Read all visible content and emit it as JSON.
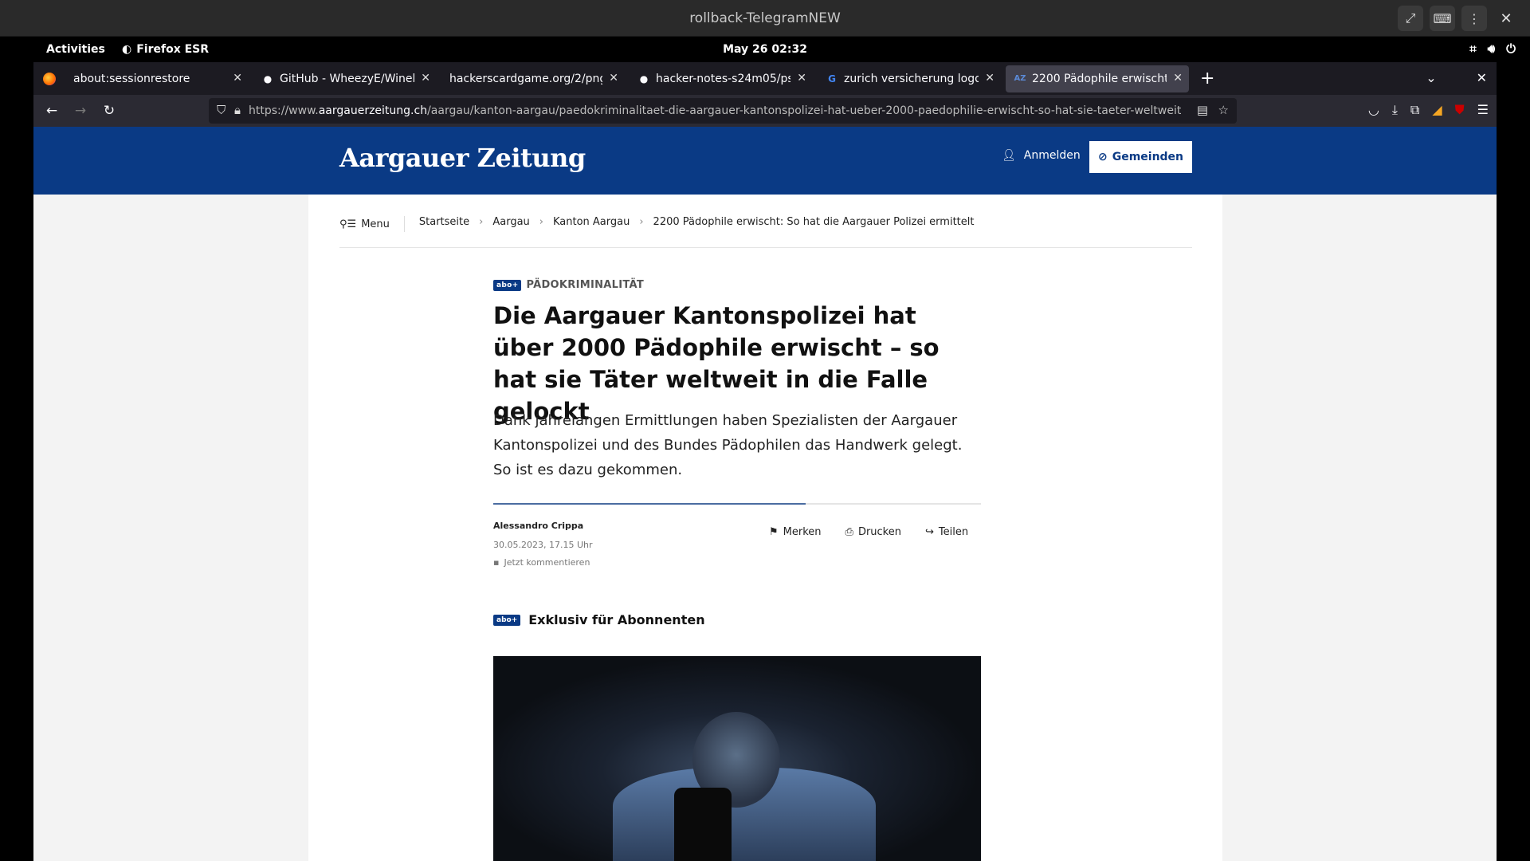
{
  "window": {
    "title": "rollback-TelegramNEW"
  },
  "gnome": {
    "activities": "Activities",
    "app": "Firefox ESR",
    "clock": "May 26  02:32"
  },
  "tabs": [
    {
      "label": "about:sessionrestore",
      "icon": "firefox-icon"
    },
    {
      "label": "GitHub - WheezyE/Winel",
      "icon": "github-icon"
    },
    {
      "label": "hackerscardgame.org/2/png/",
      "icon": "none"
    },
    {
      "label": "hacker-notes-s24m05/ps",
      "icon": "github-icon"
    },
    {
      "label": "zurich versicherung logo",
      "icon": "google-icon"
    },
    {
      "label": "2200 Pädophile erwischt",
      "icon": "az-icon"
    }
  ],
  "url": {
    "prefix": "https://www.",
    "domain": "aargauerzeitung.ch",
    "path": "/aargau/kanton-aargau/paedokriminalitaet-die-aargauer-kantonspolizei-hat-ueber-2000-paedophilie-erwischt-so-hat-sie-taeter-weltweit-in-die-"
  },
  "site": {
    "logo": "Aargauer Zeitung",
    "login": "Anmelden",
    "gemeinden": "Gemeinden"
  },
  "breadcrumb": {
    "menu": "Menu",
    "items": [
      "Startseite",
      "Aargau",
      "Kanton Aargau",
      "2200 Pädophile erwischt: So hat die Aargauer Polizei ermittelt"
    ]
  },
  "article": {
    "abo_badge": "abo+",
    "kicker": "PÄDOKRIMINALITÄT",
    "title": "Die Aargauer Kantonspolizei hat über 2000 Pädophile erwischt – so hat sie Täter weltweit in die Falle gelockt",
    "lead": "Dank jahrelangen Ermittlungen haben Spezialisten der Aargauer Kantonspolizei und des Bundes Pädophilen das Handwerk gelegt. So ist es dazu gekommen.",
    "author": "Alessandro Crippa",
    "date": "30.05.2023, 17.15 Uhr",
    "comments": "Jetzt kommentieren",
    "actions": {
      "save": "Merken",
      "print": "Drucken",
      "share": "Teilen"
    },
    "exclusive": "Exklusiv für Abonnenten",
    "reading_progress": 0.64
  },
  "colors": {
    "brand": "#0a3a85"
  }
}
